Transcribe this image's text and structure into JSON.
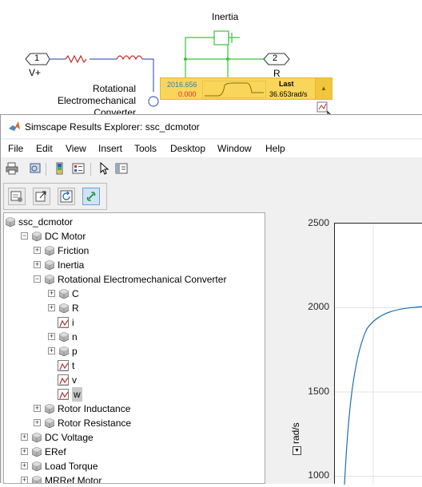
{
  "canvas": {
    "inertia_label": "Inertia",
    "port_in": {
      "number": "1",
      "label": "V+"
    },
    "port_out": {
      "number": "2",
      "label": "R"
    },
    "converter_label_lines": [
      "Rotational",
      "Electromechanical",
      "Converter"
    ],
    "sparkline": {
      "value_top": "2016.656",
      "value_bottom": "0.000",
      "last_label": "Last",
      "last_value": "36.653rad/s"
    }
  },
  "window": {
    "title": "Simscape Results Explorer: ssc_dcmotor",
    "menu": [
      "File",
      "Edit",
      "View",
      "Insert",
      "Tools",
      "Desktop",
      "Window",
      "Help"
    ],
    "toolbar_icons": [
      "print-icon",
      "print-preview-icon",
      "colorbar-icon",
      "legend-icon",
      "cursor-icon",
      "dock-icon"
    ],
    "tree_toolbar_icons": [
      "plot-options-icon",
      "export-icon",
      "refresh-icon",
      "link-icon"
    ]
  },
  "tree": [
    {
      "label": "ssc_dcmotor",
      "level": 0,
      "type": "model",
      "expand": ""
    },
    {
      "label": "DC Motor",
      "level": 1,
      "type": "block",
      "expand": "−"
    },
    {
      "label": "Friction",
      "level": 2,
      "type": "block",
      "expand": "+"
    },
    {
      "label": "Inertia",
      "level": 2,
      "type": "block",
      "expand": "+"
    },
    {
      "label": "Rotational Electromechanical Converter",
      "level": 2,
      "type": "block",
      "expand": "−"
    },
    {
      "label": "C",
      "level": 3,
      "type": "block",
      "expand": "+"
    },
    {
      "label": "R",
      "level": 3,
      "type": "block",
      "expand": "+"
    },
    {
      "label": "i",
      "level": 3,
      "type": "signal",
      "expand": ""
    },
    {
      "label": "n",
      "level": 3,
      "type": "block",
      "expand": "+"
    },
    {
      "label": "p",
      "level": 3,
      "type": "block",
      "expand": "+"
    },
    {
      "label": "t",
      "level": 3,
      "type": "signal",
      "expand": ""
    },
    {
      "label": "v",
      "level": 3,
      "type": "signal",
      "expand": ""
    },
    {
      "label": "w",
      "level": 3,
      "type": "signal",
      "expand": "",
      "selected": true
    },
    {
      "label": "Rotor Inductance",
      "level": 2,
      "type": "block",
      "expand": "+"
    },
    {
      "label": "Rotor Resistance",
      "level": 2,
      "type": "block",
      "expand": "+"
    },
    {
      "label": "DC Voltage",
      "level": 1,
      "type": "block",
      "expand": "+"
    },
    {
      "label": "ERef",
      "level": 1,
      "type": "block",
      "expand": "+"
    },
    {
      "label": "Load Torque",
      "level": 1,
      "type": "block",
      "expand": "+"
    },
    {
      "label": "MRRef Motor",
      "level": 1,
      "type": "block",
      "expand": "+"
    }
  ],
  "plot": {
    "ylabel": "rad/s",
    "yticks": [
      "2500",
      "2000",
      "1500",
      "1000"
    ]
  },
  "colors": {
    "wire_blue": "#4a64b8",
    "wire_green": "#3cc23c",
    "spark_yellow": "#f9d55a",
    "curve_blue": "#1f6fb8"
  }
}
